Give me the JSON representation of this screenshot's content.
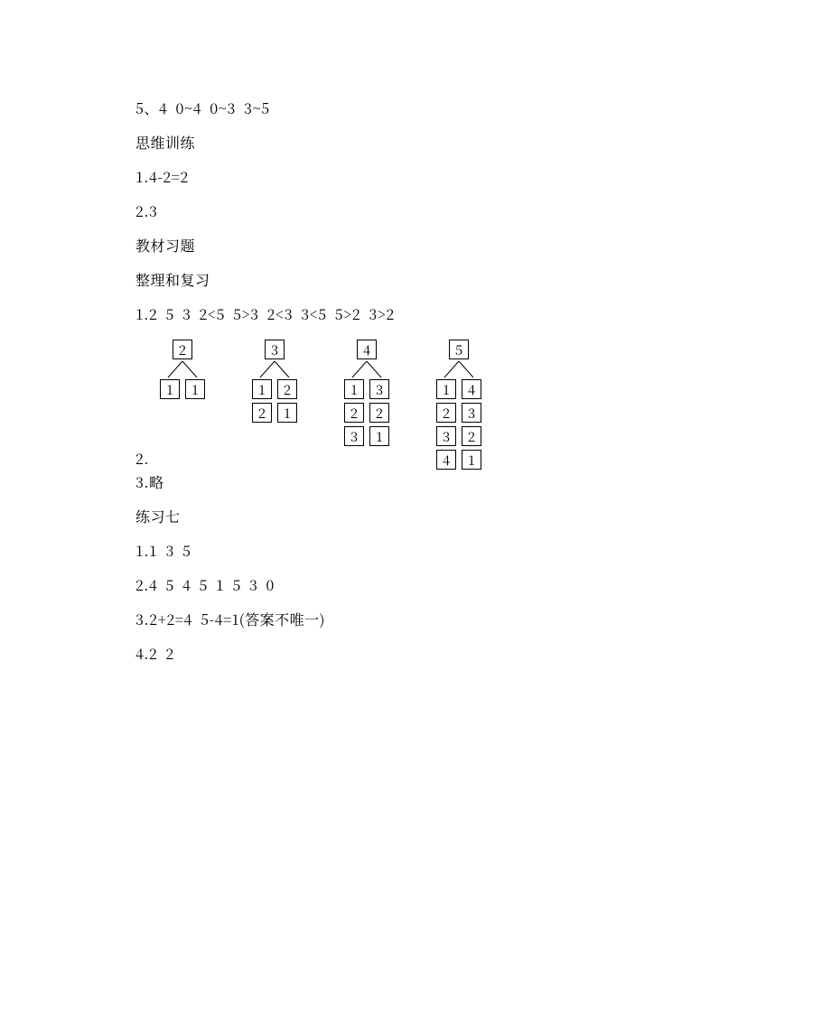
{
  "lines": {
    "l1": "5、4  0~4  0~3  3~5",
    "l2": "思维训练",
    "l3": "1.4-2=2",
    "l4": "2.3",
    "l5": "教材习题",
    "l6": "整理和复习",
    "l7": "1.2  5  3  2<5  5>3  2<3  3<5  5>2  3>2",
    "l8": "2.",
    "l9": "3.略",
    "l10": "练习七",
    "l11": "1.1  3  5",
    "l12": "2.4  5  4  5  1  5  3  0",
    "l13": "3.2+2=4  5-4=1(答案不唯一)",
    "l14": "4.2  2"
  },
  "decomp": {
    "d2": {
      "top": "2",
      "pairs": [
        [
          "1",
          "1"
        ]
      ]
    },
    "d3": {
      "top": "3",
      "pairs": [
        [
          "1",
          "2"
        ],
        [
          "2",
          "1"
        ]
      ]
    },
    "d4": {
      "top": "4",
      "pairs": [
        [
          "1",
          "3"
        ],
        [
          "2",
          "2"
        ],
        [
          "3",
          "1"
        ]
      ]
    },
    "d5": {
      "top": "5",
      "pairs": [
        [
          "1",
          "4"
        ],
        [
          "2",
          "3"
        ],
        [
          "3",
          "2"
        ],
        [
          "4",
          "1"
        ]
      ]
    }
  }
}
